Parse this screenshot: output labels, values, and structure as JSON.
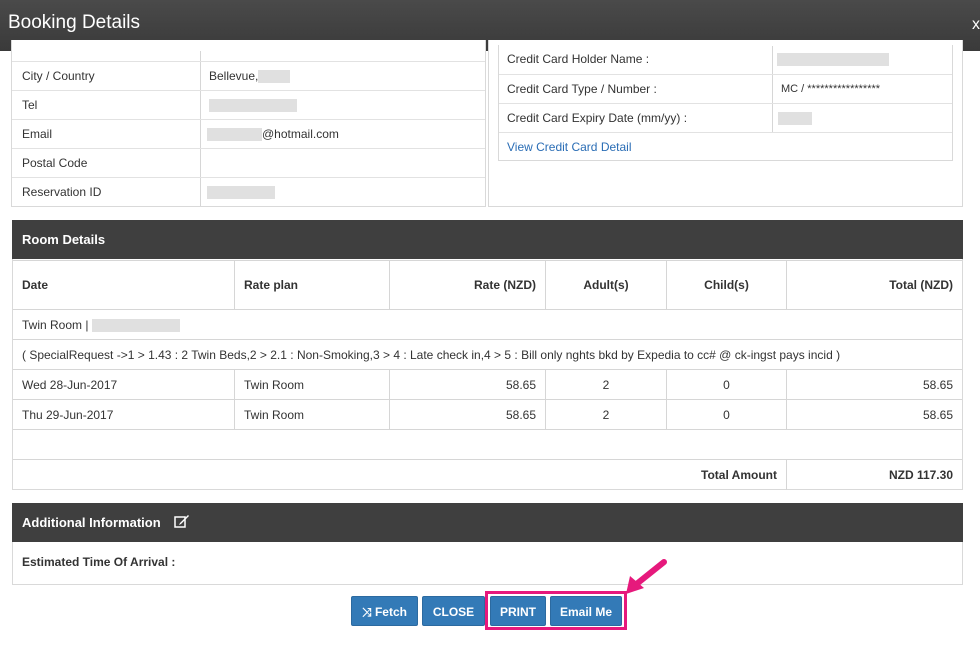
{
  "dialog": {
    "title": "Booking Details",
    "close_label": "x"
  },
  "guest": {
    "rows": [
      {
        "label": "City / Country",
        "value": "Bellevue,"
      },
      {
        "label": "Tel",
        "value": ""
      },
      {
        "label": "Email",
        "value": "@hotmail.com"
      },
      {
        "label": "Postal Code",
        "value": ""
      },
      {
        "label": "Reservation ID",
        "value": ""
      }
    ]
  },
  "payment": {
    "rows": [
      {
        "label": "Credit Card Holder Name :",
        "value": ""
      },
      {
        "label": "Credit Card Type / Number :",
        "value": "MC / *****************"
      },
      {
        "label": "Credit Card Expiry Date (mm/yy) :",
        "value": ""
      }
    ],
    "view_link": "View Credit Card Detail"
  },
  "room_details": {
    "title": "Room Details",
    "columns": [
      "Date",
      "Rate plan",
      "Rate (NZD)",
      "Adult(s)",
      "Child(s)",
      "Total (NZD)"
    ],
    "room_name": "Twin Room |",
    "special_request": "( SpecialRequest ->1 > 1.43 : 2 Twin Beds,2 > 2.1 : Non-Smoking,3 > 4 : Late check in,4 > 5 : Bill only nghts bkd by Expedia to cc# @ ck-ingst pays incid )",
    "rows": [
      {
        "date": "Wed 28-Jun-2017",
        "plan": "Twin Room",
        "rate": "58.65",
        "adults": "2",
        "children": "0",
        "total": "58.65"
      },
      {
        "date": "Thu 29-Jun-2017",
        "plan": "Twin Room",
        "rate": "58.65",
        "adults": "2",
        "children": "0",
        "total": "58.65"
      }
    ],
    "total_label": "Total Amount",
    "total_value": "NZD 117.30"
  },
  "additional": {
    "title": "Additional Information",
    "eta_label": "Estimated Time Of Arrival :"
  },
  "actions": {
    "fetch": "Fetch",
    "close": "CLOSE",
    "print": "PRINT",
    "email": "Email Me"
  },
  "colors": {
    "header_bg": "#3f3f3f",
    "button_bg": "#337ab7",
    "highlight": "#e6197c",
    "link": "#2a6db5"
  }
}
